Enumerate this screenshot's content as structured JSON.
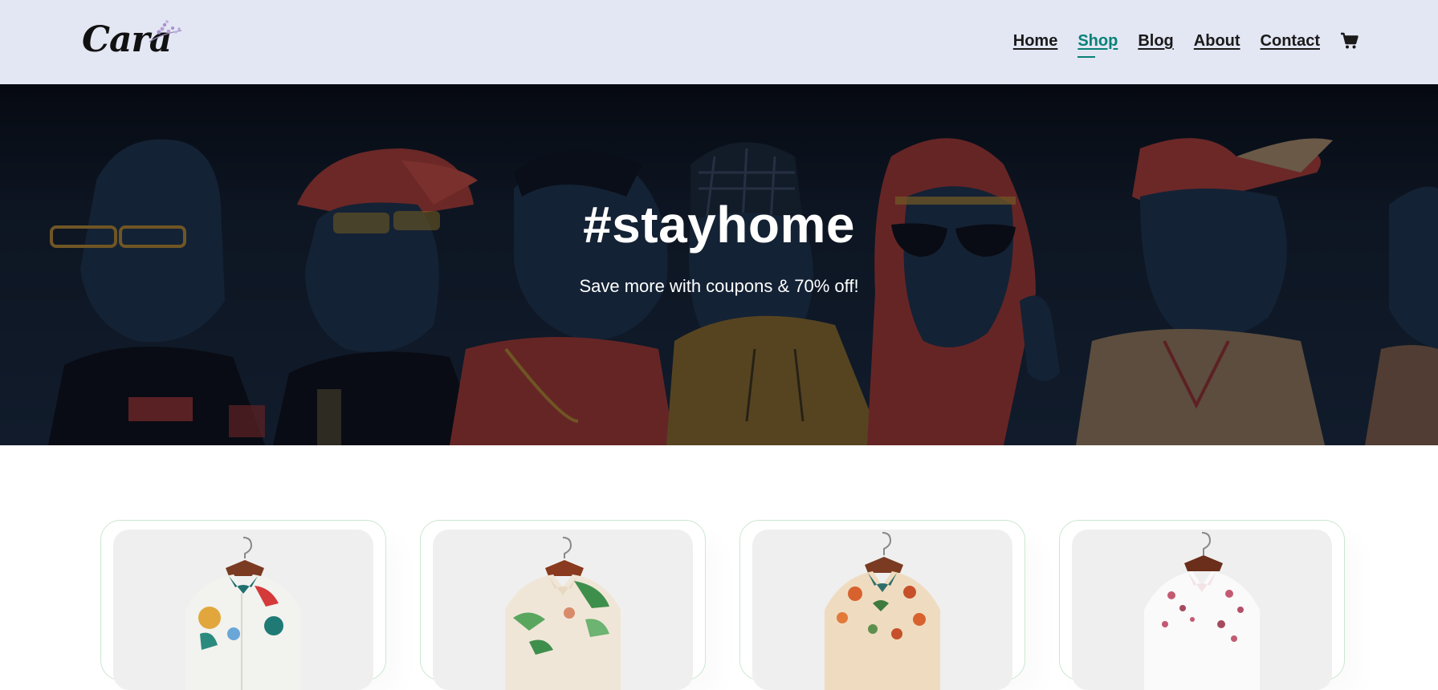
{
  "header": {
    "logo_text": "Cara",
    "nav": {
      "home": "Home",
      "shop": "Shop",
      "blog": "Blog",
      "about": "About",
      "contact": "Contact"
    },
    "active_nav": "Shop",
    "cart_icon": "shopping-cart-icon"
  },
  "hero": {
    "title": "#stayhome",
    "subtitle": "Save more with coupons & 70% off!"
  },
  "products": [
    {
      "image": "floral-shirt-multicolor"
    },
    {
      "image": "floral-shirt-green-leaves"
    },
    {
      "image": "floral-shirt-orange-roses"
    },
    {
      "image": "floral-shirt-white-pink"
    }
  ],
  "colors": {
    "header_bg": "#e3e6f3",
    "accent": "#088178",
    "card_border": "#cce7d0",
    "hero_bg": "#0b111b"
  }
}
